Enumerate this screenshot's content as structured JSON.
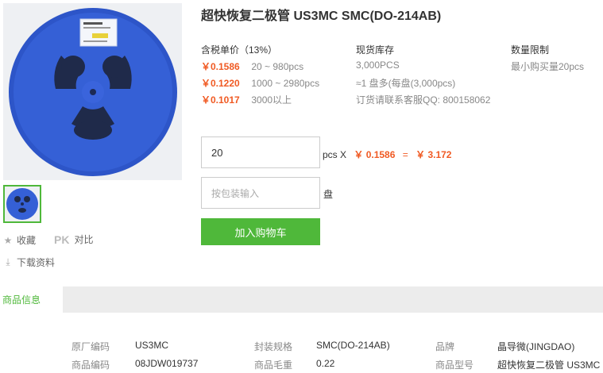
{
  "product": {
    "title": "超快恢复二极管 US3MC SMC(DO-214AB)"
  },
  "gallery": {
    "main_image": "reel-product-image",
    "thumbnail": "reel-thumbnail"
  },
  "side_actions": {
    "favorite_label": "收藏",
    "pk_badge": "PK",
    "compare_label": "对比",
    "download_label": "下载资料"
  },
  "pricing": {
    "header": "含税单价（13%）",
    "tiers": [
      {
        "price": "￥0.1586",
        "range": "20 ~ 980pcs"
      },
      {
        "price": "￥0.1220",
        "range": "1000 ~ 2980pcs"
      },
      {
        "price": "￥0.1017",
        "range": "3000以上"
      }
    ]
  },
  "stock": {
    "header": "现货库存",
    "quantity": "3,000PCS",
    "reel_info": "≈1 盘多(每盘(3,000pcs)",
    "contact": "订货请联系客服QQ: 800158062"
  },
  "limit": {
    "header": "数量限制",
    "min_order": "最小购买量20pcs"
  },
  "order": {
    "quantity_value": "20",
    "unit_x": "pcs X",
    "unit_price": "￥ 0.1586",
    "equals": "=",
    "total": "￥ 3.172",
    "reel_placeholder": "按包装输入",
    "reel_unit": "盘",
    "add_to_cart": "加入购物车"
  },
  "tabs": {
    "active": "商品信息"
  },
  "specs": {
    "factory_code_label": "原厂编码",
    "factory_code": "US3MC",
    "package_label": "封装规格",
    "package": "SMC(DO-214AB)",
    "brand_label": "品牌",
    "brand": "晶导微(JINGDAO)",
    "product_code_label": "商品编码",
    "product_code": "08JDW019737",
    "weight_label": "商品毛重",
    "weight": "0.22",
    "model_label": "商品型号",
    "model": "超快恢复二极管 US3MC"
  },
  "colors": {
    "accent_green": "#4fb83a",
    "price_red": "#f05a23",
    "reel_blue": "#2d55c8"
  }
}
